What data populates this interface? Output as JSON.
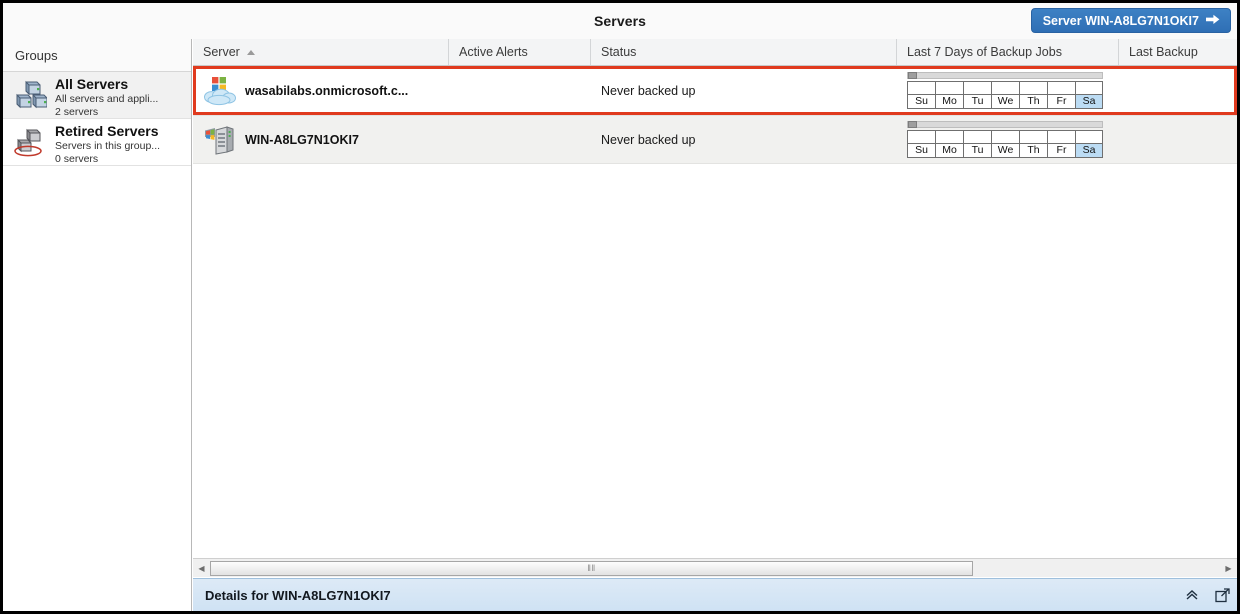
{
  "window": {
    "title": "Servers"
  },
  "header": {
    "server_button_label": "Server WIN-A8LG7N1OKI7",
    "server_button_icon": "arrow-right-icon"
  },
  "sidebar": {
    "header_label": "Groups",
    "items": [
      {
        "title": "All Servers",
        "description": "All servers and appli...",
        "count": "2 servers",
        "icon": "servers-group-icon",
        "selected": true
      },
      {
        "title": "Retired Servers",
        "description": "Servers in this group...",
        "count": "0 servers",
        "icon": "retired-servers-icon",
        "selected": false
      }
    ]
  },
  "grid": {
    "columns": [
      {
        "label": "Server",
        "sort": "asc"
      },
      {
        "label": "Active Alerts",
        "sort": ""
      },
      {
        "label": "Status",
        "sort": ""
      },
      {
        "label": "Last 7 Days of Backup Jobs",
        "sort": ""
      },
      {
        "label": "Last Backup",
        "sort": ""
      }
    ],
    "day_labels": [
      "Su",
      "Mo",
      "Tu",
      "We",
      "Th",
      "Fr",
      "Sa"
    ],
    "today_index": 6,
    "rows": [
      {
        "server": "wasabilabs.onmicrosoft.c...",
        "icon": "microsoft365-cloud-icon",
        "active_alerts": "",
        "status": "Never backed up",
        "last_backup": "",
        "selected": true
      },
      {
        "server": "WIN-A8LG7N1OKI7",
        "icon": "windows-server-icon",
        "active_alerts": "",
        "status": "Never backed up",
        "last_backup": "",
        "selected": false
      }
    ]
  },
  "scrollbar": {
    "left_arrow": "◀",
    "right_arrow": "▶",
    "grip": "‖‖"
  },
  "details": {
    "title": "Details for WIN-A8LG7N1OKI7",
    "collapse_icon": "chevron-up-icon",
    "popout_icon": "popout-icon"
  },
  "colors": {
    "accent_blue": "#2f6fb5",
    "selection_red": "#e03a1e",
    "today_highlight": "#bcdcf4",
    "details_bar": "#cfe2f4"
  }
}
